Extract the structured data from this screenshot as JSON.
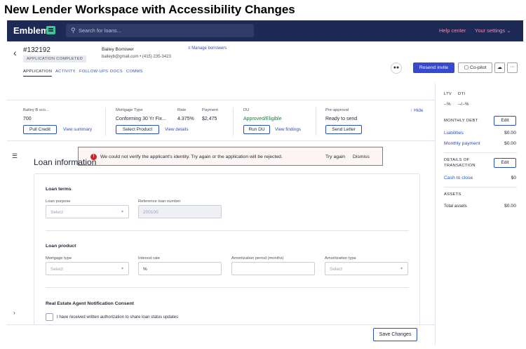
{
  "caption": "New Lender Workspace with Accessibility Changes",
  "topnav": {
    "logo": "Emblem",
    "search_placeholder": "Search for loans...",
    "help": "Help center",
    "settings": "Your settings"
  },
  "header": {
    "loan_id": "#132192",
    "status": "APPLICATION COMPLETED",
    "borrower": "Bailey Borrower",
    "contact": "baileyb@gmail.com • (415) 235-3423",
    "manage": "Manage borrowers",
    "tabs": [
      "APPLICATION",
      "ACTIVITY",
      "FOLLOW-UPS",
      "DOCS",
      "COMMS"
    ],
    "resend": "Resend invite",
    "copilot": "Co-pilot"
  },
  "summary": {
    "credit_label": "Bailey B sco...",
    "credit_value": "700",
    "pull_credit": "Pull Credit",
    "view_summary": "View summary",
    "mortgage_type_label": "Mortgage Type",
    "mortgage_type_value": "Conforming 30 Yr Fix...",
    "rate_label": "Rate",
    "rate_value": "4.375%",
    "payment_label": "Payment",
    "payment_value": "$2,475",
    "select_product": "Select Product",
    "view_details": "View details",
    "du_label": "DU",
    "du_value": "Approved/Eligible",
    "run_du": "Run DU",
    "view_findings": "View findings",
    "preapproval_label": "Pre-approval",
    "preapproval_value": "Ready to send",
    "send_letter": "Send Letter",
    "hide": "Hide"
  },
  "alert": {
    "message": "We could not verify the applicant's identity. Try again or the application will be rejected.",
    "try_again": "Try again",
    "dismiss": "Dismiss"
  },
  "loan_info": {
    "title": "Loan information",
    "loan_terms": "Loan terms",
    "loan_purpose_label": "Loan purpose",
    "loan_purpose_value": "Select",
    "ref_label": "Reference loan number",
    "ref_value": "200100",
    "loan_product": "Loan product",
    "mortgage_type_label": "Mortgage type",
    "mortgage_type_value": "Select",
    "interest_label": "Interest rate",
    "interest_value": "%",
    "amort_period_label": "Amortization period (months)",
    "amort_type_label": "Amortization type",
    "amort_type_value": "Select",
    "consent_title": "Real Estate Agent Notification Consent",
    "consent_label": "I have received written authorization to share loan status updates"
  },
  "footer": {
    "save": "Save Changes"
  },
  "right_panel": {
    "ltv_label": "LTV",
    "dti_label": "DTI",
    "ltv_value": "--%",
    "dti_value": "--/--%",
    "monthly_debt": "MONTHLY DEBT",
    "edit": "Edit",
    "liabilities": "Liabilities",
    "liabilities_value": "$0.00",
    "monthly_payment": "Monthly payment",
    "monthly_payment_value": "$0.00",
    "details_1": "DETAILS OF",
    "details_2": "TRANSACTION",
    "cash_to_close": "Cash to close",
    "cash_to_close_value": "$0",
    "assets": "ASSETS",
    "total_assets": "Total assets",
    "total_assets_value": "$0.00"
  }
}
